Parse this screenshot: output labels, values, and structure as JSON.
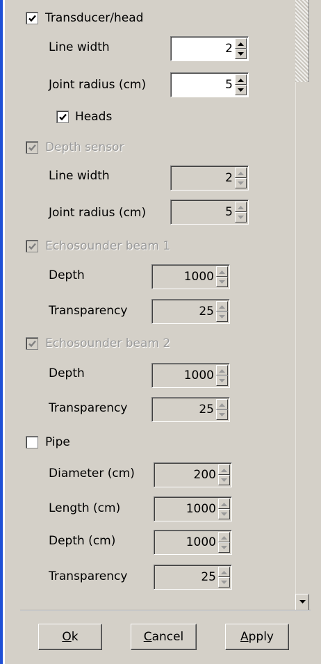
{
  "sections": {
    "transducer": {
      "label": "Transducer/head",
      "checked": true,
      "enabled": true,
      "line_width_label": "Line width",
      "line_width": "2",
      "joint_radius_label": "Joint radius (cm)",
      "joint_radius": "5",
      "heads_label": "Heads",
      "heads_checked": true
    },
    "depth_sensor": {
      "label": "Depth sensor",
      "checked": true,
      "enabled": false,
      "line_width_label": "Line width",
      "line_width": "2",
      "joint_radius_label": "Joint radius (cm)",
      "joint_radius": "5"
    },
    "beam1": {
      "label": "Echosounder beam 1",
      "checked": true,
      "enabled": false,
      "depth_label": "Depth",
      "depth": "1000",
      "transparency_label": "Transparency",
      "transparency": "25"
    },
    "beam2": {
      "label": "Echosounder beam 2",
      "checked": true,
      "enabled": false,
      "depth_label": "Depth",
      "depth": "1000",
      "transparency_label": "Transparency",
      "transparency": "25"
    },
    "pipe": {
      "label": "Pipe",
      "checked": false,
      "enabled": true,
      "diameter_label": "Diameter (cm)",
      "diameter": "200",
      "length_label": "Length (cm)",
      "length": "1000",
      "depth_label": "Depth (cm)",
      "depth": "1000",
      "transparency_label": "Transparency",
      "transparency": "25"
    }
  },
  "buttons": {
    "ok": {
      "mnemonic": "O",
      "rest": "k"
    },
    "cancel": {
      "mnemonic": "C",
      "rest": "ancel"
    },
    "apply": {
      "mnemonic": "A",
      "rest": "pply"
    }
  },
  "colors": {
    "face": "#d4d0c8",
    "disabled_text": "#9a9a9a",
    "frame_accent": "#1f50d6"
  },
  "icons": {
    "check": "check-icon",
    "up": "arrow-up-icon",
    "down": "arrow-down-icon"
  }
}
